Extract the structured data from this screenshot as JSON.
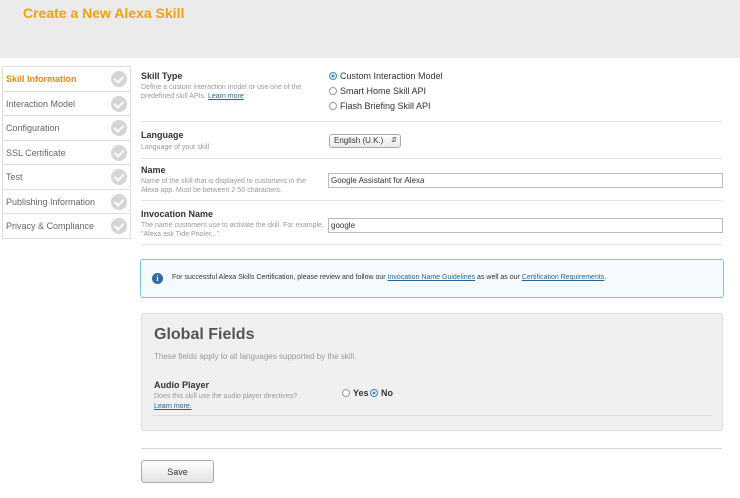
{
  "header": {
    "title": "Create a New Alexa Skill"
  },
  "sidebar": {
    "items": [
      {
        "label": "Skill Information"
      },
      {
        "label": "Interaction Model"
      },
      {
        "label": "Configuration"
      },
      {
        "label": "SSL Certificate"
      },
      {
        "label": "Test"
      },
      {
        "label": "Publishing Information"
      },
      {
        "label": "Privacy & Compliance"
      }
    ],
    "active_index": 0
  },
  "skill_type": {
    "label": "Skill Type",
    "help": "Define a custom interaction model or use one of the predefined skill APIs.",
    "learn_more": "Learn more",
    "options": [
      "Custom Interaction Model",
      "Smart Home Skill API",
      "Flash Briefing Skill API"
    ],
    "selected": "Custom Interaction Model"
  },
  "language": {
    "label": "Language",
    "help": "Language of your skill",
    "value": "English (U.K.)"
  },
  "name": {
    "label": "Name",
    "help": "Name of the skill that is displayed to customers in the Alexa app. Must be between 2-50 characters.",
    "value": "Google Assistant for Alexa"
  },
  "invocation": {
    "label": "Invocation Name",
    "help": "The name customers use to activate the skill. For example, \"Alexa ask Tide Pooler...\".",
    "value": "google"
  },
  "info_banner": {
    "icon": "info-icon",
    "text_before": "For successful Alexa Skills Certification, please review and follow our ",
    "link1": "Invocation Name Guidelines",
    "text_middle": " as well as our ",
    "link2": "Certification Requirements",
    "text_after": "."
  },
  "global_fields": {
    "title": "Global Fields",
    "subtitle": "These fields apply to all languages supported by the skill.",
    "audio_player": {
      "label": "Audio Player",
      "help": "Does this skill use the audio player directives?",
      "learn_more": "Learn more.",
      "yes_label": "Yes",
      "no_label": "No",
      "selected": "No"
    }
  },
  "actions": {
    "save_label": "Save"
  },
  "colors": {
    "accent": "#f0a30a",
    "link": "#2a6496",
    "radio_selected": "#3b88c3",
    "info_border": "#7fc4de"
  }
}
